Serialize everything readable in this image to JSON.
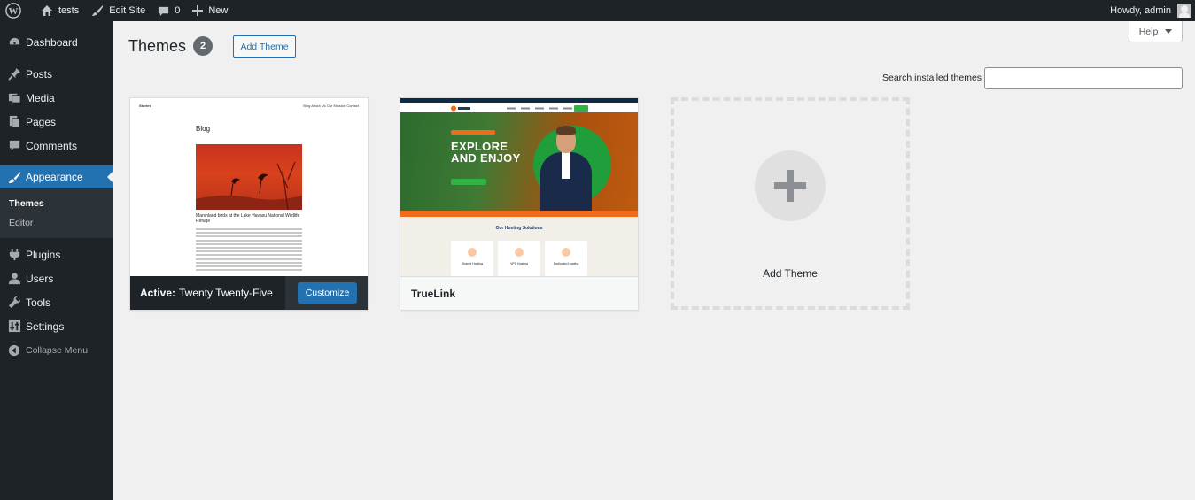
{
  "adminbar": {
    "site_name": "tests",
    "edit_site": "Edit Site",
    "comments_count": "0",
    "new_label": "New",
    "howdy": "Howdy, admin"
  },
  "sidebar": {
    "items": [
      {
        "label": "Dashboard",
        "icon": "dashboard-icon"
      },
      {
        "label": "Posts",
        "icon": "pin-icon"
      },
      {
        "label": "Media",
        "icon": "media-icon"
      },
      {
        "label": "Pages",
        "icon": "pages-icon"
      },
      {
        "label": "Comments",
        "icon": "comment-icon"
      },
      {
        "label": "Appearance",
        "icon": "brush-icon"
      },
      {
        "label": "Plugins",
        "icon": "plugin-icon"
      },
      {
        "label": "Users",
        "icon": "users-icon"
      },
      {
        "label": "Tools",
        "icon": "wrench-icon"
      },
      {
        "label": "Settings",
        "icon": "settings-icon"
      }
    ],
    "submenu": [
      "Themes",
      "Editor"
    ],
    "collapse": "Collapse Menu"
  },
  "header": {
    "title": "Themes",
    "count": "2",
    "add_theme": "Add Theme",
    "help": "Help"
  },
  "search": {
    "label": "Search installed themes",
    "value": ""
  },
  "themes": [
    {
      "active_prefix": "Active:",
      "name": "Twenty Twenty-Five",
      "customize": "Customize",
      "preview": {
        "site": "Stories",
        "nav": "Blog  About Us  Our Mission  Contact",
        "heading": "Blog",
        "caption": "Marshland birds at the Lake Havasu National Wildlife Refuge"
      }
    },
    {
      "name": "TrueLink",
      "preview": {
        "hero_title_1": "EXPLORE",
        "hero_title_2": "AND ENJOY",
        "solutions": "Our Hosting Solutions",
        "cards": [
          "Shared Hosting",
          "VPS Hosting",
          "Dedicated Hosting"
        ]
      }
    }
  ],
  "add_new": {
    "label": "Add Theme"
  },
  "colors": {
    "accent": "#2271b1",
    "adminbar": "#1d2327",
    "background": "#f0f0f1"
  }
}
